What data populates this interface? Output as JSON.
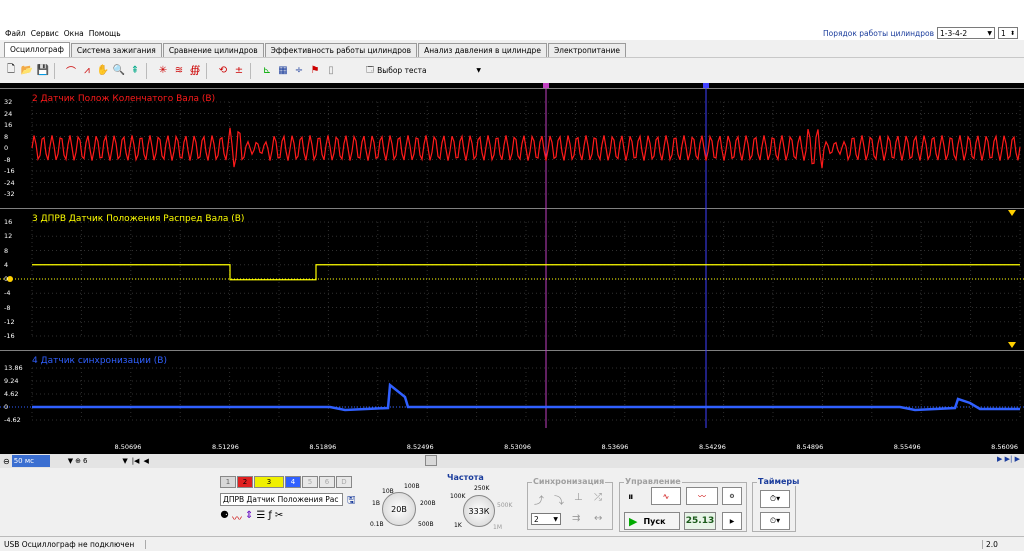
{
  "menu": [
    "Файл",
    "Сервис",
    "Окна",
    "Помощь"
  ],
  "cylinder_order": {
    "label": "Порядок работы цилиндров",
    "value": "1-3-4-2",
    "spin": "1"
  },
  "tabs": [
    "Осциллограф",
    "Система зажигания",
    "Сравнение цилиндров",
    "Эффективность работы цилиндров",
    "Анализ давления в цилиндре",
    "Электропитание"
  ],
  "toolbar": {
    "test_select": "Выбор теста"
  },
  "scope": {
    "panels": [
      {
        "label": "2 Датчик Полож Коленчатого Вала (В)",
        "color": "#ff1a1a",
        "yticks": [
          "32",
          "24",
          "16",
          "8",
          "0",
          "-8",
          "-16",
          "-24",
          "-32"
        ]
      },
      {
        "label": "3 ДПРВ Датчик Положения Распред Вала (В)",
        "color": "#ffff00",
        "yticks": [
          "16",
          "12",
          "8",
          "4",
          "0",
          "-4",
          "-8",
          "-12",
          "-16"
        ]
      },
      {
        "label": "4 Датчик синхронизации (В)",
        "color": "#3060ff",
        "yticks": [
          "13.86",
          "9.24",
          "4.62",
          "0",
          "-4.62"
        ]
      }
    ],
    "x_ticks": [
      "8.50696",
      "8.51296",
      "8.51896",
      "8.52496",
      "8.53096",
      "8.53696",
      "8.54296",
      "8.54896",
      "8.55496",
      "8.56096"
    ]
  },
  "scroll": {
    "time_div": "50 мс",
    "channels": "6"
  },
  "control": {
    "channel_buttons": [
      "1",
      "2",
      "3",
      "4",
      "5",
      "6",
      "D"
    ],
    "channel_name": "ДПРВ Датчик Положения Рас",
    "volts_dial": {
      "value": "20В",
      "labels": [
        "10В",
        "100В",
        "1В",
        "200В",
        "0.1В",
        "500В"
      ]
    },
    "freq_title": "Частота",
    "freq_dial": {
      "value": "333К",
      "labels": [
        "250K",
        "100K",
        "500K",
        "1K",
        "1M"
      ]
    },
    "sync_title": "Синхронизация",
    "sync_value": "2",
    "mgmt_title": "Управление",
    "start_label": "Пуск",
    "fps": "25.13",
    "timers_title": "Таймеры"
  },
  "status": {
    "text": "USB Осциллограф не подключен",
    "version": "2.0"
  }
}
